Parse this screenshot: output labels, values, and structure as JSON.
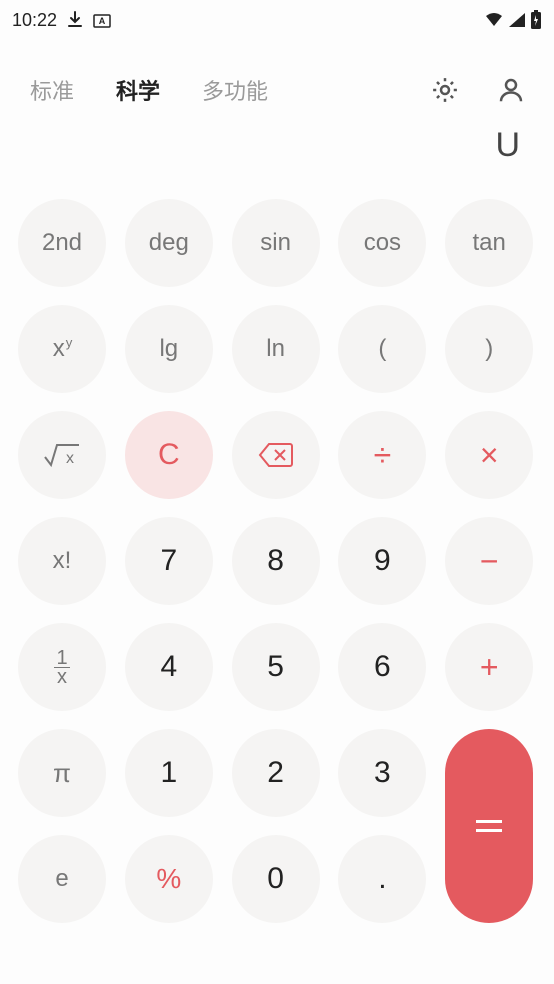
{
  "status": {
    "time": "10:22"
  },
  "header": {
    "tabs": [
      "标准",
      "科学",
      "多功能"
    ],
    "activeTab": 1
  },
  "display": {
    "value": "U"
  },
  "keys": {
    "row1": [
      "2nd",
      "deg",
      "sin",
      "cos",
      "tan"
    ],
    "row2": [
      "xʸ",
      "lg",
      "ln",
      "(",
      ")"
    ],
    "row3": [
      "√x",
      "C",
      "⌫",
      "÷",
      "×"
    ],
    "row4": [
      "x!",
      "7",
      "8",
      "9",
      "−"
    ],
    "row5": [
      "¹⁄ₓ",
      "4",
      "5",
      "6",
      "+"
    ],
    "row6": [
      "π",
      "1",
      "2",
      "3"
    ],
    "row7": [
      "e",
      "%",
      "0",
      "."
    ],
    "equals": "="
  },
  "colors": {
    "accent": "#e45a5f",
    "keyBg": "#f5f4f3",
    "clearBg": "#f9e4e4"
  }
}
